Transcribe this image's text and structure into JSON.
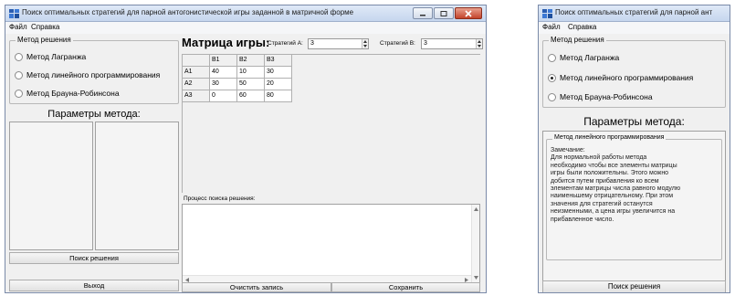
{
  "left_window": {
    "title": "Поиск оптимальных стратегий для парной антогонистической игры заданной в матричной форме",
    "menu": [
      "Файл",
      "Справка"
    ],
    "method_group": {
      "legend": "Метод решения",
      "options": [
        "Метод Лагранжа",
        "Метод линейного программирования",
        "Метод Брауна-Робинсона"
      ],
      "selected": "none"
    },
    "params_title": "Параметры метода:",
    "search_button": "Поиск решения",
    "exit_button": "Выход",
    "matrix_title": "Матрица игры:",
    "strategy_a_label": "Стратегий А:",
    "strategy_a_value": "3",
    "strategy_b_label": "Стратегий В:",
    "strategy_b_value": "3",
    "matrix": {
      "columns": [
        "B1",
        "B2",
        "B3"
      ],
      "rows": [
        {
          "label": "A1",
          "values": [
            "40",
            "10",
            "30"
          ]
        },
        {
          "label": "A2",
          "values": [
            "30",
            "50",
            "20"
          ]
        },
        {
          "label": "A3",
          "values": [
            "0",
            "60",
            "80"
          ]
        }
      ]
    },
    "process_label": "Процесс поиска решения:",
    "clear_button": "Очистить запись",
    "save_button": "Сохранить"
  },
  "right_window": {
    "title": "Поиск оптимальных стратегий для парной ант",
    "menu": [
      "Файл",
      "Справка"
    ],
    "method_group": {
      "legend": "Метод решения",
      "options": [
        "Метод Лагранжа",
        "Метод линейного программирования",
        "Метод Брауна-Робинсона"
      ],
      "selected": "Метод линейного программирования"
    },
    "params_title": "Параметры метода:",
    "lp_group_legend": "Метод линейного программирования",
    "note_lines": [
      "Замечание:",
      "Для нормальной работы метода",
      "необходимо чтобы все элементы матрицы",
      "игры были положительны. Этого можно",
      "добится путем прибавления ко всем",
      "элементам матрицы числа равного модулю",
      "наименьшему отрицательному. При этом",
      "значения для стратегий останутся",
      "неизменными, а цена игры увеличится на",
      "прибавленное число."
    ],
    "search_button": "Поиск решения"
  },
  "colors": {
    "accent_title": "#c6d6ee",
    "close_button": "#c3432a",
    "window_bg": "#f0f0f0"
  }
}
